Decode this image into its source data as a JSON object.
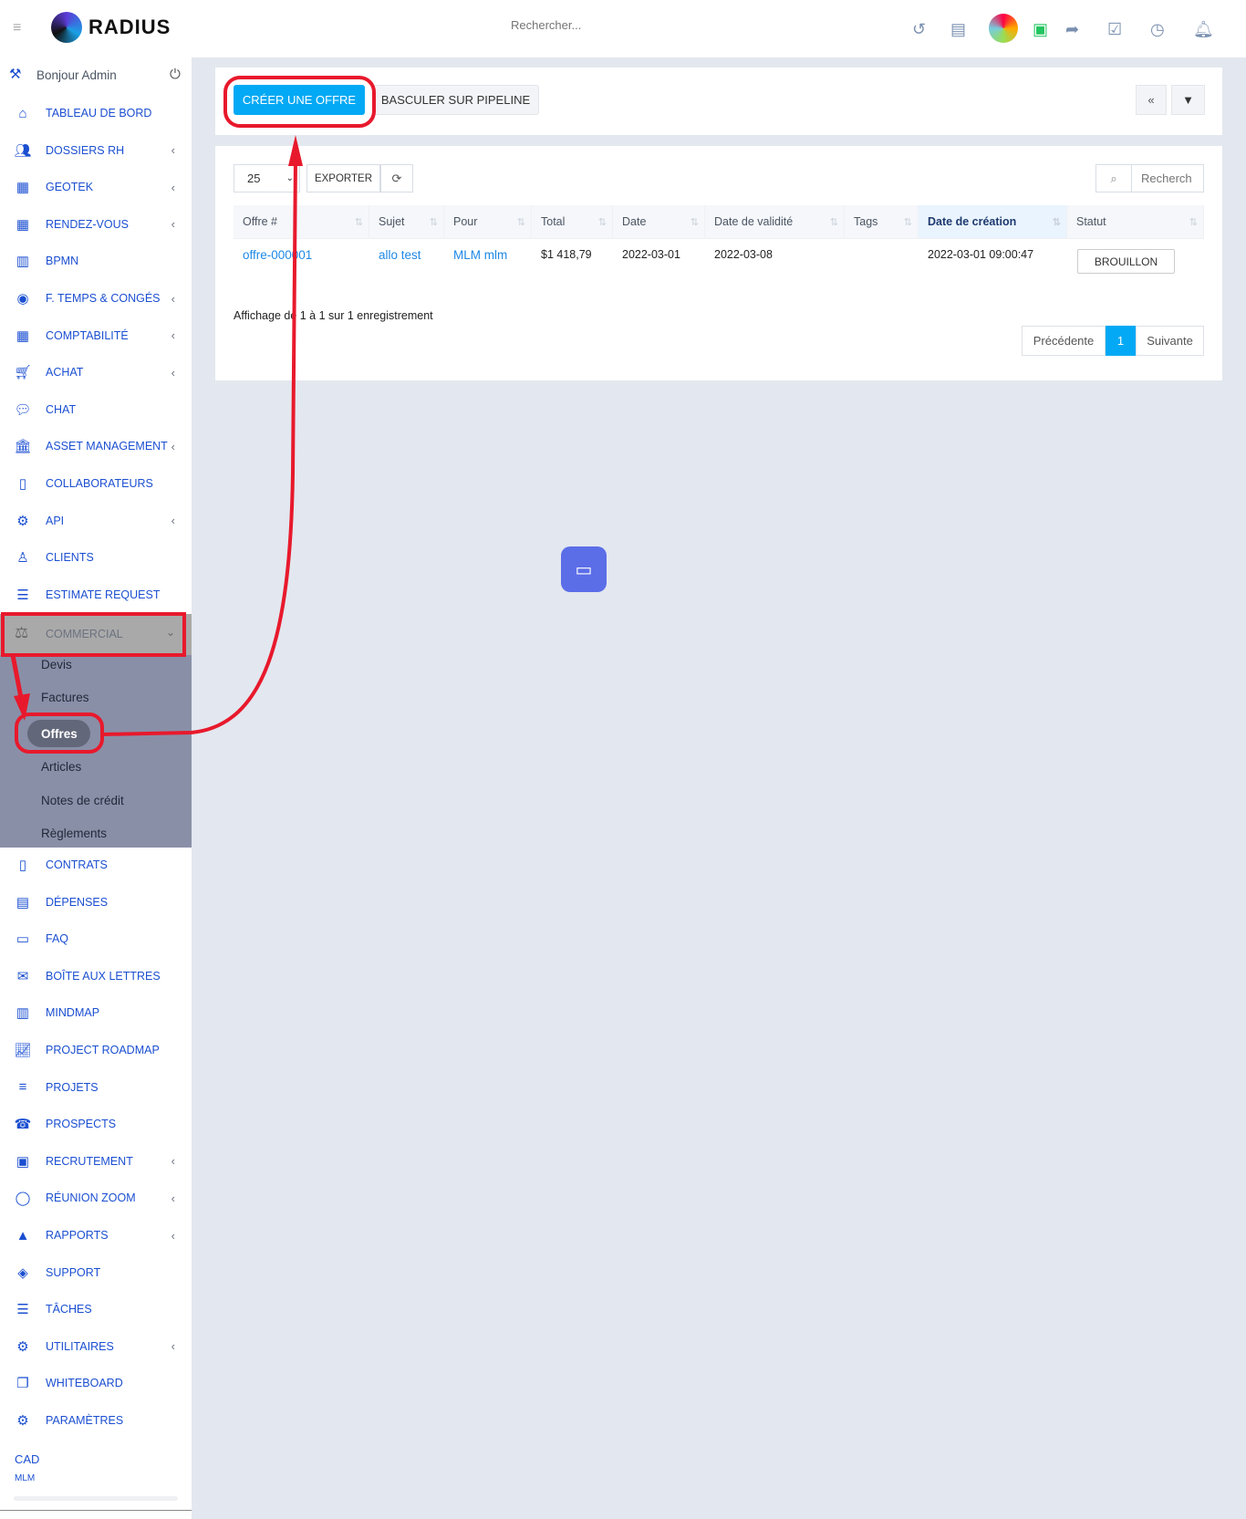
{
  "header": {
    "logo": "RADIUS",
    "search_placeholder": "Rechercher...",
    "icons": [
      "history-icon",
      "contact-card-icon",
      "globe-avatar-icon",
      "user-chat-icon",
      "share-icon",
      "checkbox-icon",
      "clock-icon",
      "bell-icon"
    ]
  },
  "sidebar": {
    "greeting": "Bonjour Admin",
    "items": [
      {
        "label": "Tableau de bord",
        "icon": "home-icon"
      },
      {
        "label": "Dossiers RH",
        "icon": "users-icon",
        "chev": true
      },
      {
        "label": "Geotek",
        "icon": "calendar-icon",
        "chev": true
      },
      {
        "label": "Rendez-vous",
        "icon": "calendar-icon",
        "chev": true
      },
      {
        "label": "BPMN",
        "icon": "map-icon"
      },
      {
        "label": "F. Temps & Congés",
        "icon": "user-circle-icon",
        "chev": true
      },
      {
        "label": "Comptabilité",
        "icon": "calculator-icon",
        "chev": true
      },
      {
        "label": "Achat",
        "icon": "cart-icon",
        "chev": true
      },
      {
        "label": "Chat",
        "icon": "chat-icon"
      },
      {
        "label": "Asset Management",
        "icon": "bank-icon",
        "chev": true
      },
      {
        "label": "Collaborateurs",
        "icon": "file-icon"
      },
      {
        "label": "API",
        "icon": "cogs-icon",
        "chev": true
      },
      {
        "label": "Clients",
        "icon": "user-icon"
      },
      {
        "label": "Estimate Request",
        "icon": "list-icon"
      }
    ],
    "commercial": {
      "label": "Commercial",
      "icon": "scale-icon",
      "sub": [
        "Devis",
        "Factures",
        "Offres",
        "Articles",
        "Notes de crédit",
        "Règlements"
      ],
      "active": "Offres"
    },
    "items2": [
      {
        "label": "Contrats",
        "icon": "file-icon"
      },
      {
        "label": "Dépenses",
        "icon": "file-text-icon"
      },
      {
        "label": "FAQ",
        "icon": "folder-icon"
      },
      {
        "label": "Boîte aux lettres",
        "icon": "mail-icon"
      },
      {
        "label": "Mindmap",
        "icon": "map-icon"
      },
      {
        "label": "Project Roadmap",
        "icon": "chart-line-icon"
      },
      {
        "label": "Projets",
        "icon": "bars-icon"
      },
      {
        "label": "Prospects",
        "icon": "phone-icon"
      },
      {
        "label": "Recrutement",
        "icon": "id-icon",
        "chev": true
      },
      {
        "label": "Réunion Zoom",
        "icon": "comment-icon",
        "chev": true
      },
      {
        "label": "Rapports",
        "icon": "area-chart-icon",
        "chev": true
      },
      {
        "label": "Support",
        "icon": "ticket-icon"
      },
      {
        "label": "Tâches",
        "icon": "tasks-icon"
      },
      {
        "label": "Utilitaires",
        "icon": "cogs-icon",
        "chev": true
      },
      {
        "label": "Whiteboard",
        "icon": "copy-icon"
      },
      {
        "label": "Paramètres",
        "icon": "gear-icon"
      }
    ],
    "currency": "CAD",
    "company": "MLM"
  },
  "toolbar": {
    "create": "CRÉER UNE OFFRE",
    "pipeline": "BASCULER SUR PIPELINE"
  },
  "table": {
    "page_size": "25",
    "export": "EXPORTER",
    "search_placeholder": "Recherch",
    "columns": [
      "Offre #",
      "Sujet",
      "Pour",
      "Total",
      "Date",
      "Date de validité",
      "Tags",
      "Date de création",
      "Statut"
    ],
    "rows": [
      {
        "offre": "offre-000001",
        "sujet": "allo test",
        "pour": "MLM mlm",
        "total": "$1 418,79",
        "date": "2022-03-01",
        "validite": "2022-03-08",
        "tags": "",
        "creation": "2022-03-01 09:00:47",
        "statut": "BROUILLON"
      }
    ],
    "info": "Affichage de 1 à 1 sur 1 enregistrement",
    "pagination": {
      "prev": "Précédente",
      "current": "1",
      "next": "Suivante"
    }
  },
  "colors": {
    "accent": "#03a9f4",
    "nav": "#1b4fd1",
    "annotation": "#e8192c",
    "submenu_bg": "#8a8fa8"
  }
}
